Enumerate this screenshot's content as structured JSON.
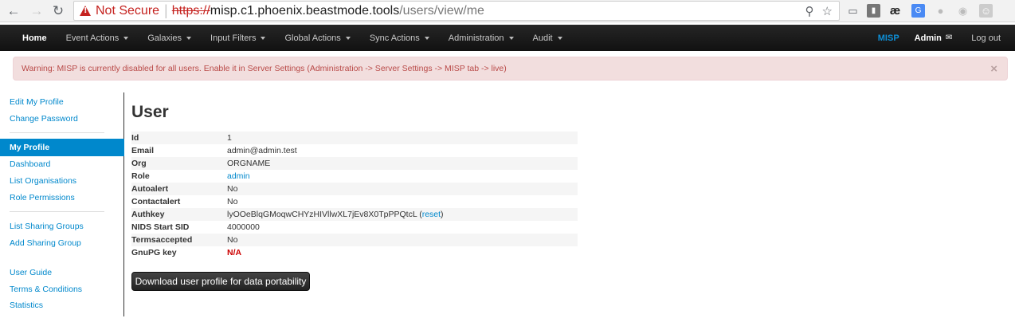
{
  "browser": {
    "security_label": "Not Secure",
    "url_scheme": "https://",
    "url_host": "misp.c1.phoenix.beastmode.tools",
    "url_path": "/users/view/me",
    "icons": [
      "back-arrow-icon",
      "forward-arrow-icon",
      "reload-icon",
      "warning-icon",
      "zoom-icon",
      "star-icon",
      "cast-icon",
      "extension-icon",
      "ae-extension-icon",
      "translate-icon",
      "extension-icon",
      "circle-extension-icon",
      "profile-icon"
    ],
    "ext_ae_label": "æ"
  },
  "navbar": {
    "home": "Home",
    "menus": [
      "Event Actions",
      "Galaxies",
      "Input Filters",
      "Global Actions",
      "Sync Actions",
      "Administration",
      "Audit"
    ],
    "brand": "MISP",
    "user": "Admin",
    "logout": "Log out"
  },
  "alert": {
    "message": "Warning: MISP is currently disabled for all users. Enable it in Server Settings (Administration -> Server Settings -> MISP tab -> live)",
    "close": "×"
  },
  "sidebar": {
    "group1": [
      "Edit My Profile",
      "Change Password"
    ],
    "active": "My Profile",
    "group2": [
      "Dashboard",
      "List Organisations",
      "Role Permissions"
    ],
    "group3": [
      "List Sharing Groups",
      "Add Sharing Group"
    ],
    "group4": [
      "User Guide",
      "Terms & Conditions",
      "Statistics"
    ]
  },
  "main": {
    "title": "User",
    "rows": {
      "id": {
        "label": "Id",
        "value": "1"
      },
      "email": {
        "label": "Email",
        "value": "admin@admin.test"
      },
      "org": {
        "label": "Org",
        "value": "ORGNAME"
      },
      "role": {
        "label": "Role",
        "value": "admin"
      },
      "autoalert": {
        "label": "Autoalert",
        "value": "No"
      },
      "contactalert": {
        "label": "Contactalert",
        "value": "No"
      },
      "authkey": {
        "label": "Authkey",
        "value": "lyOOeBlqGMoqwCHYzHIVllwXL7jEv8X0TpPPQtcL",
        "open": " (",
        "reset": "reset",
        "close": ")"
      },
      "nids": {
        "label": "NIDS Start SID",
        "value": "4000000"
      },
      "terms": {
        "label": "Termsaccepted",
        "value": "No"
      },
      "gnupg": {
        "label": "GnuPG key",
        "value": "N/A"
      }
    },
    "download_button": "Download user profile for data portability"
  },
  "colors": {
    "navbar_bg": "#1c1c1c",
    "link": "#0088cc",
    "alert_bg": "#f2dede",
    "alert_text": "#b94a48",
    "danger": "#cc0000"
  }
}
